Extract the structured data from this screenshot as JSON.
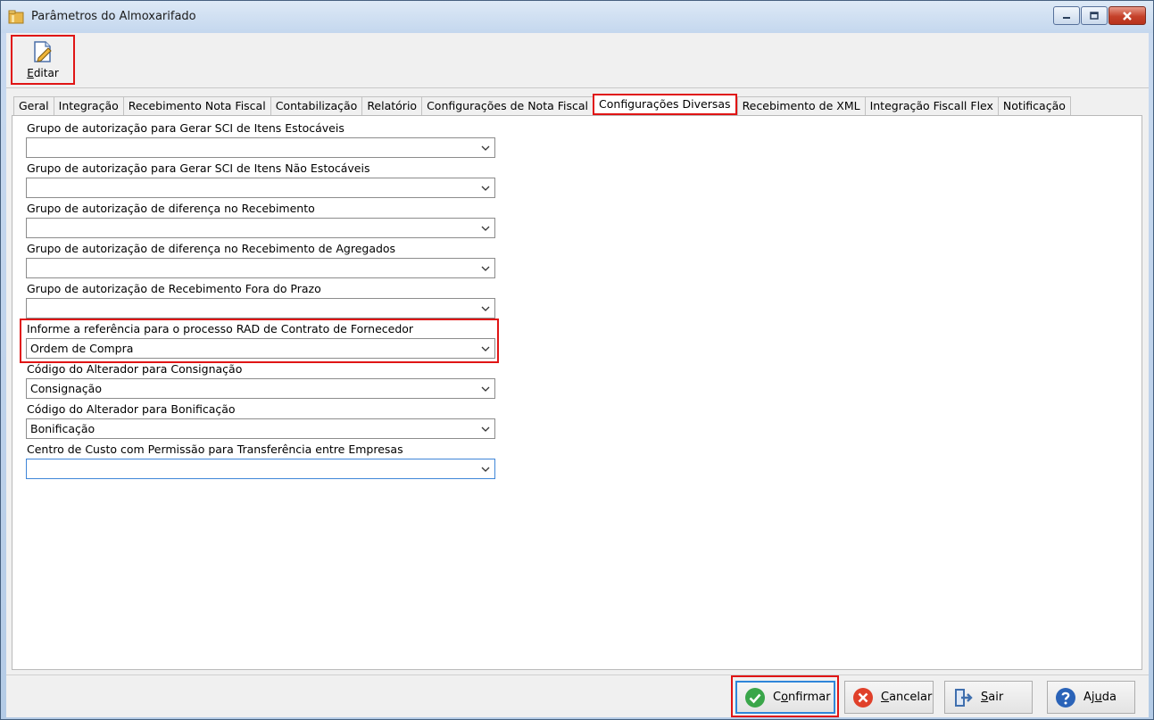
{
  "window": {
    "title": "Parâmetros do Almoxarifado"
  },
  "toolbar": {
    "edit_label_accel": "E",
    "edit_label_rest": "ditar"
  },
  "tabs": [
    {
      "label": "Geral"
    },
    {
      "label": "Integração"
    },
    {
      "label": "Recebimento Nota Fiscal"
    },
    {
      "label": "Contabilização"
    },
    {
      "label": "Relatório"
    },
    {
      "label": "Configurações de Nota Fiscal"
    },
    {
      "label": "Configurações Diversas",
      "active": true
    },
    {
      "label": "Recebimento de XML"
    },
    {
      "label": "Integração Fiscall Flex"
    },
    {
      "label": "Notificação"
    }
  ],
  "fields": [
    {
      "label": "Grupo de autorização para Gerar SCI de Itens Estocáveis",
      "value": ""
    },
    {
      "label": "Grupo de autorização para Gerar SCI de Itens Não Estocáveis",
      "value": ""
    },
    {
      "label": "Grupo de autorização de diferença no Recebimento",
      "value": ""
    },
    {
      "label": "Grupo de autorização de diferença no Recebimento de Agregados",
      "value": ""
    },
    {
      "label": "Grupo de autorização de Recebimento Fora do Prazo",
      "value": ""
    },
    {
      "label": "Informe a referência para o processo RAD de Contrato de Fornecedor",
      "value": "Ordem de Compra"
    },
    {
      "label": "Código do Alterador para Consignação",
      "value": "Consignação"
    },
    {
      "label": "Código do Alterador para Bonificação",
      "value": "Bonificação"
    },
    {
      "label": "Centro de Custo com Permissão para Transferência entre Empresas",
      "value": ""
    }
  ],
  "footer": {
    "confirm": {
      "accel": "o",
      "pre": "C",
      "post": "nfirmar"
    },
    "cancel": {
      "accel": "C",
      "post": "ancelar"
    },
    "exit": {
      "accel": "S",
      "post": "air"
    },
    "help": {
      "pre": "Aj",
      "accel": "u",
      "post": "da"
    }
  },
  "colors": {
    "highlight": "#e01515",
    "focus_border": "#3f86d8",
    "confirm_icon": "#3aa64a",
    "cancel_icon": "#e0402a",
    "help_icon": "#2a63b8",
    "exit_icon": "#3f6fae"
  },
  "icons": {
    "app": "folder-icon",
    "edit": "edit-document-icon",
    "confirm": "check-circle-icon",
    "cancel": "x-circle-icon",
    "exit": "exit-door-icon",
    "help": "question-circle-icon"
  }
}
